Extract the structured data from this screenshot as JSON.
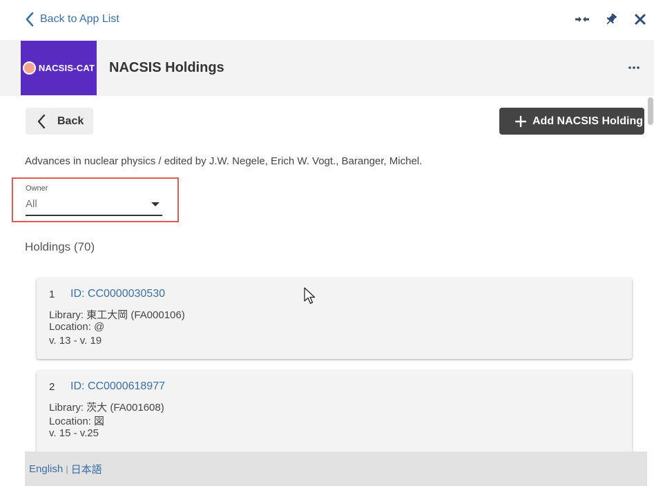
{
  "topbar": {
    "back_to_app_list": "Back to App List",
    "icons": [
      "chevron-left-icon",
      "collapse-arrows-icon",
      "pin-icon",
      "close-icon"
    ]
  },
  "header": {
    "logo_text": "NACSIS-CAT",
    "title": "NACSIS Holdings",
    "logo_color": "#5a2bc2"
  },
  "toolbar": {
    "back_label": "Back",
    "add_label": "Add NACSIS Holding"
  },
  "record": {
    "title": "Advances in nuclear physics / edited by J.W. Negele, Erich W. Vogt., Baranger, Michel."
  },
  "owner": {
    "label": "Owner",
    "value": "All"
  },
  "holdings": {
    "title": "Holdings (70)",
    "items": [
      {
        "num": "1",
        "id": "ID: CC0000030530",
        "library": "Library: 東工大岡 (FA000106)",
        "location": "Location: @",
        "volumes": "v. 13 - v. 19"
      },
      {
        "num": "2",
        "id": "ID: CC0000618977",
        "library": "Library: 茨大 (FA001608)",
        "location": "Location: 図",
        "volumes": "v. 15 - v.25"
      }
    ]
  },
  "footer": {
    "lang_en": "English",
    "separator": "|",
    "lang_ja": "日本語"
  },
  "colors": {
    "accent_link": "#3a6ea5",
    "highlight_border": "#e25a52",
    "dark_button": "#444444"
  }
}
